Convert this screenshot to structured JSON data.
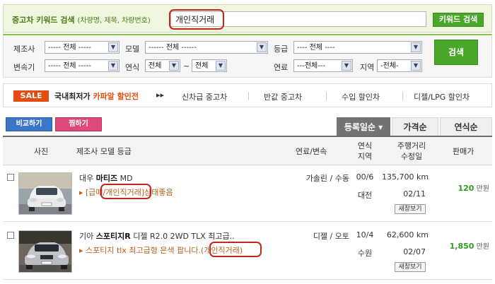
{
  "keyword_search": {
    "label": "중고차 키워드 검색",
    "sublabel": "(차량명, 제목, 차량번호)",
    "value": "개인직거래",
    "button": "키워드 검색"
  },
  "filters": {
    "maker": {
      "label": "제조사",
      "value": "----- 전체 -----"
    },
    "model": {
      "label": "모델",
      "value": "------ 전체 ------"
    },
    "grade": {
      "label": "등급",
      "value": "---- 전체 ----"
    },
    "transmission": {
      "label": "변속기",
      "value": "----- 전체 -----"
    },
    "year": {
      "label": "연식",
      "from": "전체",
      "to": "전체",
      "separator": "~"
    },
    "fuel": {
      "label": "연료",
      "value": "---전체---"
    },
    "region": {
      "label": "지역",
      "value": "-전체-"
    },
    "search_button": "검색"
  },
  "promo": {
    "badge": "SALE",
    "title_plain": "국내최저가 ",
    "title_accent": "카파알 할인전",
    "arrow": "▸▸",
    "links": [
      "신차급 중고차",
      "반값 중고차",
      "수입 할인차",
      "디젤/LPG 할인차"
    ]
  },
  "actions": {
    "compare": "비교하기",
    "wish": "찜하기"
  },
  "sort_tabs": [
    {
      "label": "등록일순 ▾",
      "active": true
    },
    {
      "label": "가격순",
      "active": false
    },
    {
      "label": "연식순",
      "active": false
    }
  ],
  "table": {
    "headers": {
      "photo": "사진",
      "maker_model": "제조사  모델  등급",
      "fuel": "연료/변속",
      "year": "연식",
      "region": "지역",
      "mileage": "주행거리",
      "modified": "수정일",
      "price": "판매가"
    },
    "rows": [
      {
        "maker": "대우",
        "model": "마티즈",
        "grade": "MD",
        "desc_prefix": "▸ [급매/",
        "desc_highlight": "개인직거래",
        "desc_suffix": "]상태좋음",
        "fuel": "가솔린 / 수동",
        "year": "00/6",
        "region": "대전",
        "mileage": "135,700 km",
        "modified": "02/11",
        "new_view": "새창보기",
        "price": "120",
        "price_unit": "만원"
      },
      {
        "maker": "기아",
        "model": "스포티지R",
        "grade": "디젤 R2.0 2WD TLX 최고급..",
        "desc_prefix": "▸ 스포티지 tlx 최고급형 은색 팝니다.(",
        "desc_highlight": "개인직거래",
        "desc_suffix": ")",
        "fuel": "디젤 / 오토",
        "year": "10/4",
        "region": "수원",
        "mileage": "62,600 km",
        "modified": "02/07",
        "new_view": "새창보기",
        "price": "1,850",
        "price_unit": "만원"
      }
    ]
  },
  "colors": {
    "highlight": "#c3261d",
    "brand_green": "#4aa72a",
    "sale_orange": "#e64c0f",
    "price_green": "#2e9b1e"
  }
}
